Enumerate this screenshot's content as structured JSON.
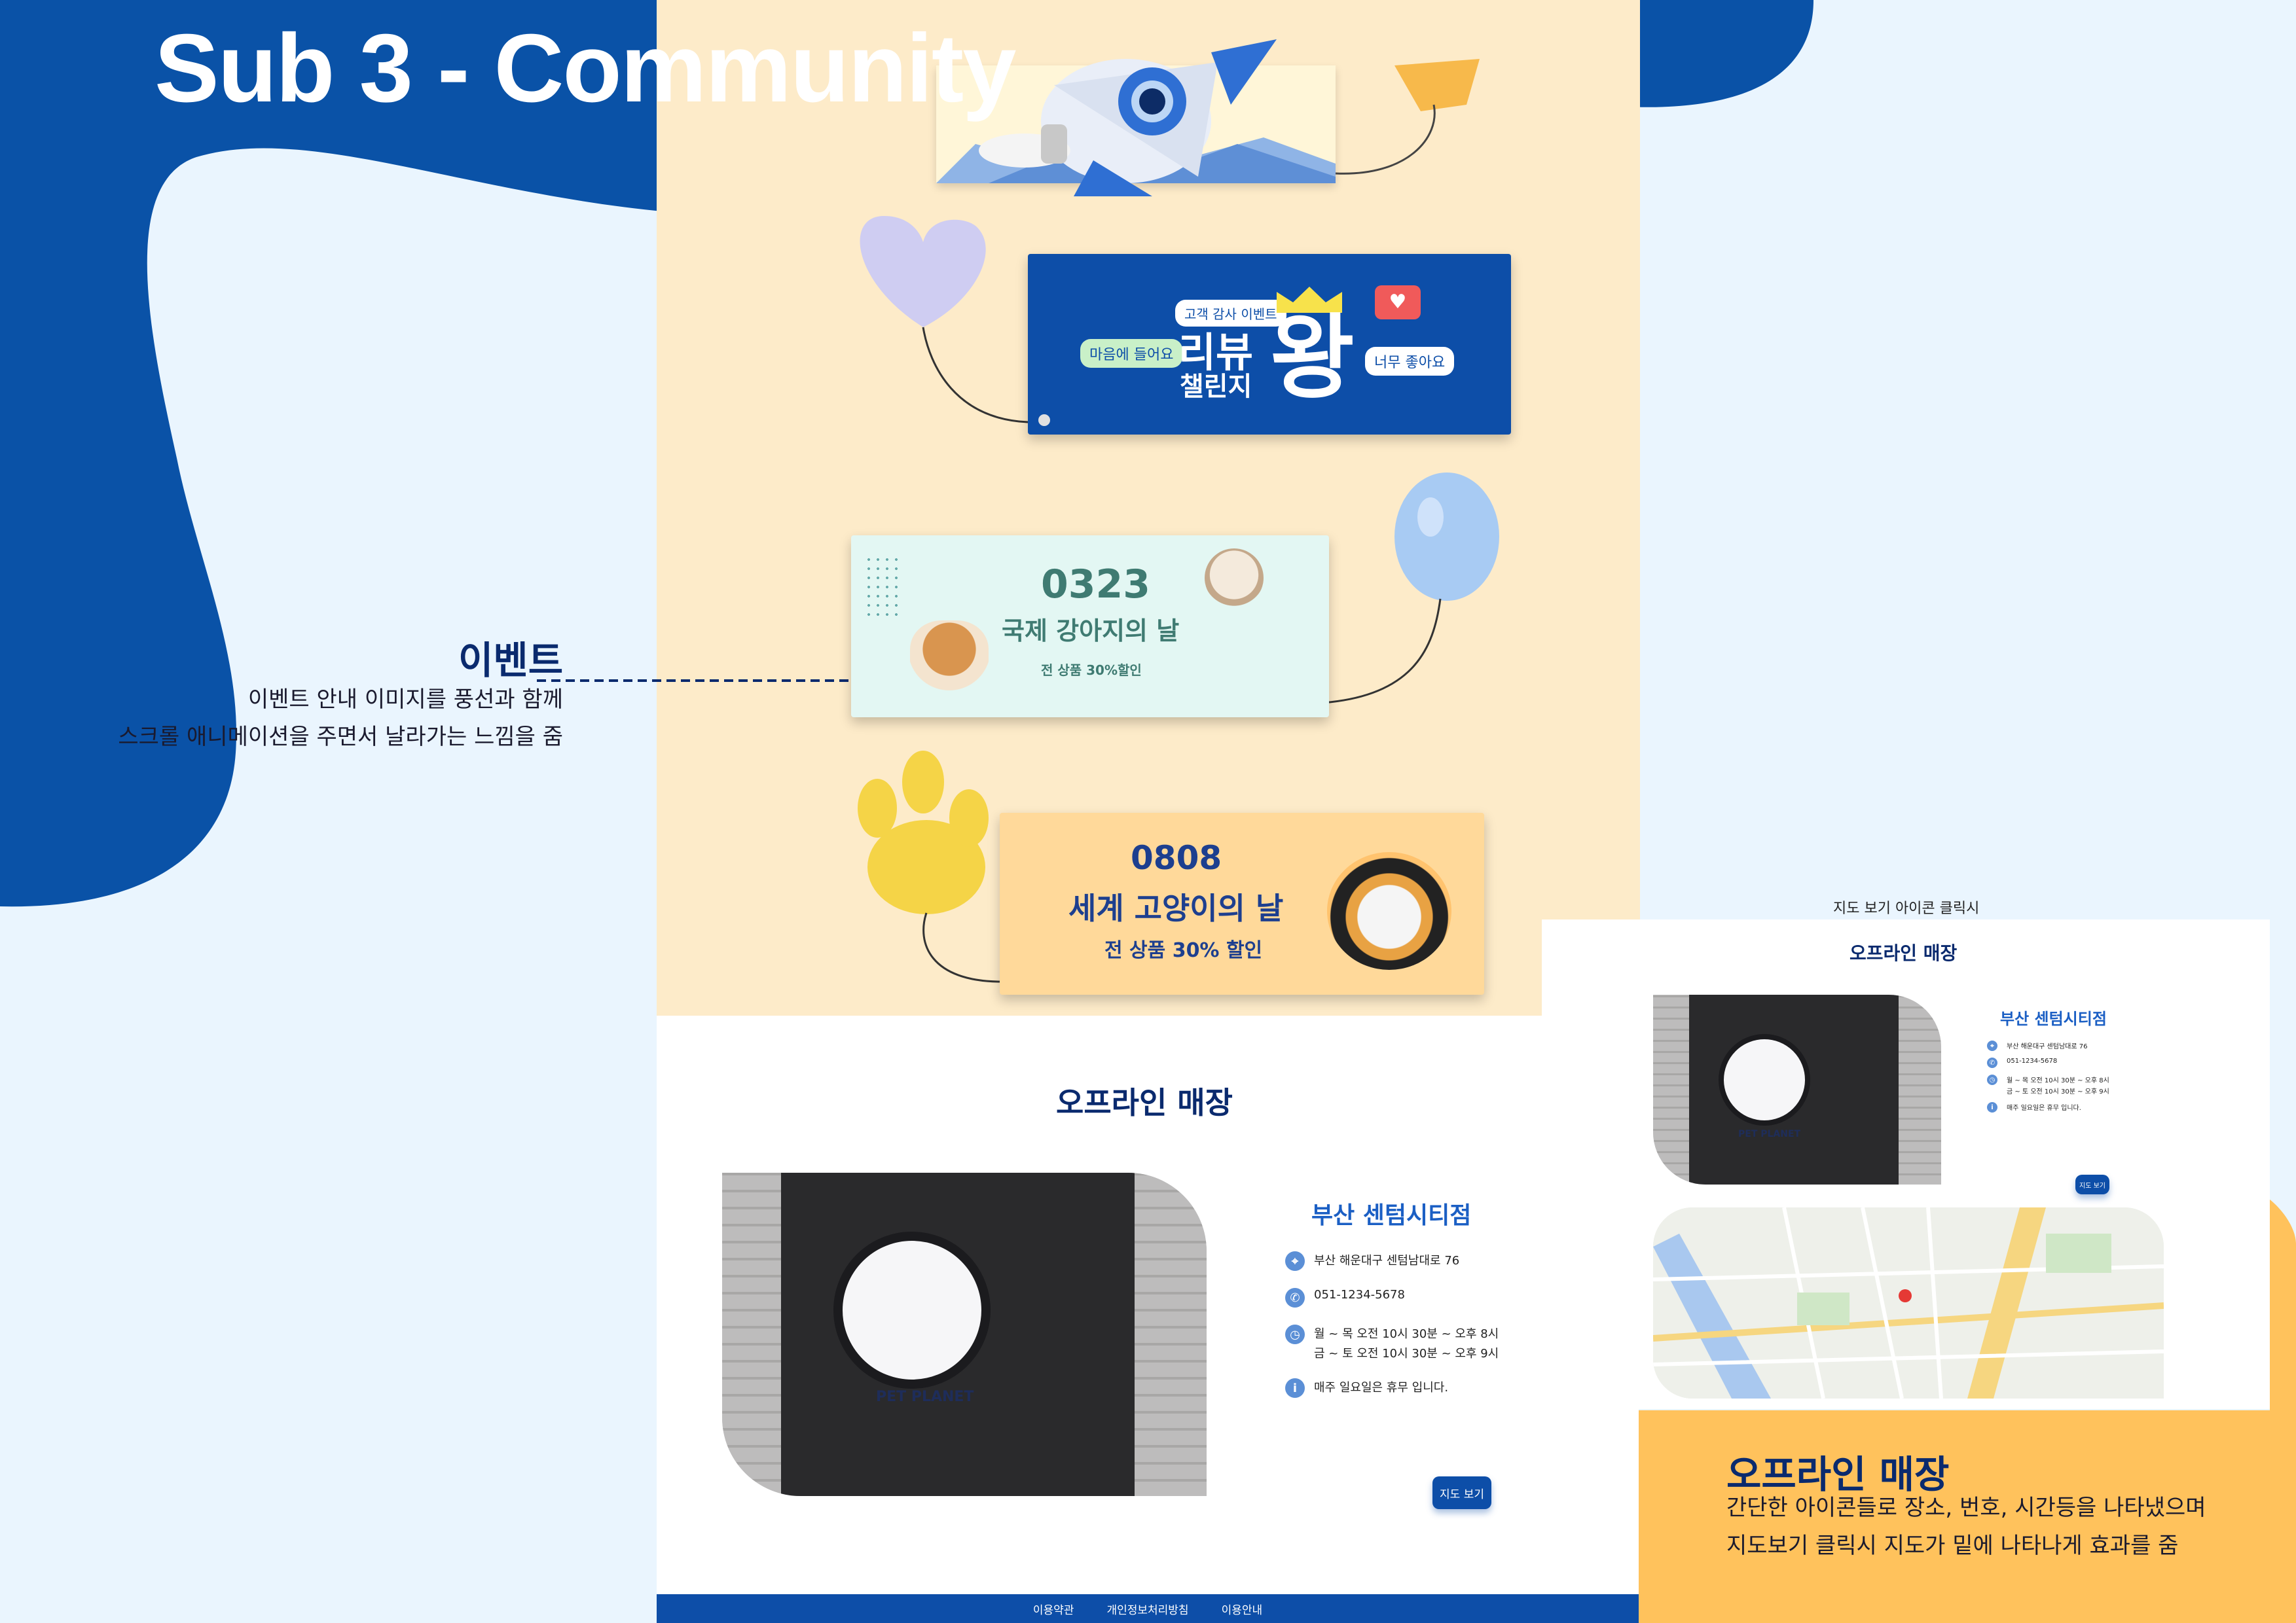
{
  "page": {
    "title": "Sub 3 - Community"
  },
  "colors": {
    "brand_blue": "#0d4ea8",
    "navy": "#0a2a6e",
    "cream": "#fdebc9",
    "orange": "#ffc25c",
    "light_bg": "#eaf5fe"
  },
  "review_banner": {
    "tag": "고객 감사 이벤트",
    "title_line1": "리뷰",
    "title_line2": "챌린지",
    "king": "왕",
    "bubble_left": "마음에 들어요",
    "bubble_right": "너무 좋아요"
  },
  "dog_banner": {
    "date": "0323",
    "title": "국제 강아지의 날",
    "discount": "전 상품 30%할인"
  },
  "cat_banner": {
    "date": "0808",
    "title": "세계 고양이의 날",
    "discount": "전 상품 30% 할인"
  },
  "event_note": {
    "title": "이벤트",
    "line1": "이벤트 안내 이미지를 풍선과 함께",
    "line2": "스크롤 애니메이션을 주면서 날라가는 느낌을 줌"
  },
  "store": {
    "section_title": "오프라인 매장",
    "branch": "부산 센텀시티점",
    "address": "부산 해운대구 센텀남대로 76",
    "phone": "051-1234-5678",
    "hours_line1": "월 ~ 목 오전 10시 30분 ~ 오후 8시",
    "hours_line2": "금 ~ 토 오전 10시 30분 ~ 오후 9시",
    "closed": "매주 일요일은 휴무 입니다.",
    "map_button": "지도 보기",
    "sign_text": "PET PLANET"
  },
  "store_note": {
    "title": "오프라인 매장",
    "line1": "간단한 아이콘들로 장소, 번호, 시간등을 나타냈으며",
    "line2": "지도보기 클릭시 지도가 밑에 나타나게 효과를 줌"
  },
  "map_caption": "지도 보기 아이콘 클릭시",
  "icons": [
    "location-pin-icon",
    "phone-icon",
    "clock-icon",
    "info-icon"
  ],
  "footer": {
    "links": [
      "이용약관",
      "개인정보처리방침",
      "이용안내"
    ]
  }
}
